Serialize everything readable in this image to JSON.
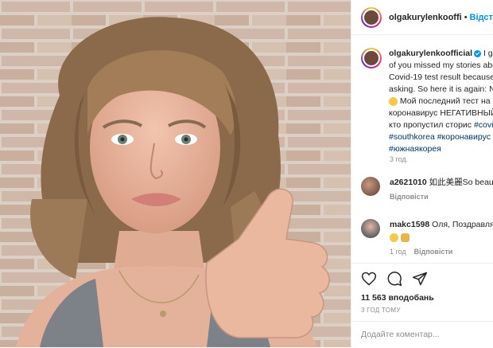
{
  "header": {
    "username": "olgakurylenkooffi",
    "separator": "•",
    "follow_label": "Відстеж"
  },
  "caption": {
    "username": "olgakurylenkoofficial",
    "lines_en": [
      "I gu",
      "of you missed my stories abo",
      "Covid-19 test result because",
      "asking. So here it is again: N"
    ],
    "line_ru1": "Мой последний тест на",
    "line_ru2": "коронавирус НЕГАТИВНЫЙ",
    "line_ru3_text": "кто пропустил сторис ",
    "line_ru3_tag": "#covi",
    "tags_line1a": "#southkorea",
    "tags_line1b": "#коронавирус",
    "tags_line2": "#южнаякорея",
    "time": "3 год."
  },
  "comments": [
    {
      "username": "a2621010",
      "text": "如此美麗So beauty",
      "reply_label": "Відповісти"
    },
    {
      "username": "makc1598",
      "text": "Оля, Поздравлям",
      "time": "1 год",
      "reply_label": "Відповісти"
    }
  ],
  "actions": {
    "icons": [
      "heart-icon",
      "comment-icon",
      "share-icon"
    ],
    "likes": "11 563 вподобань",
    "posted": "3 ГОД ТОМУ"
  },
  "add_comment": {
    "placeholder": "Додайте коментар..."
  }
}
